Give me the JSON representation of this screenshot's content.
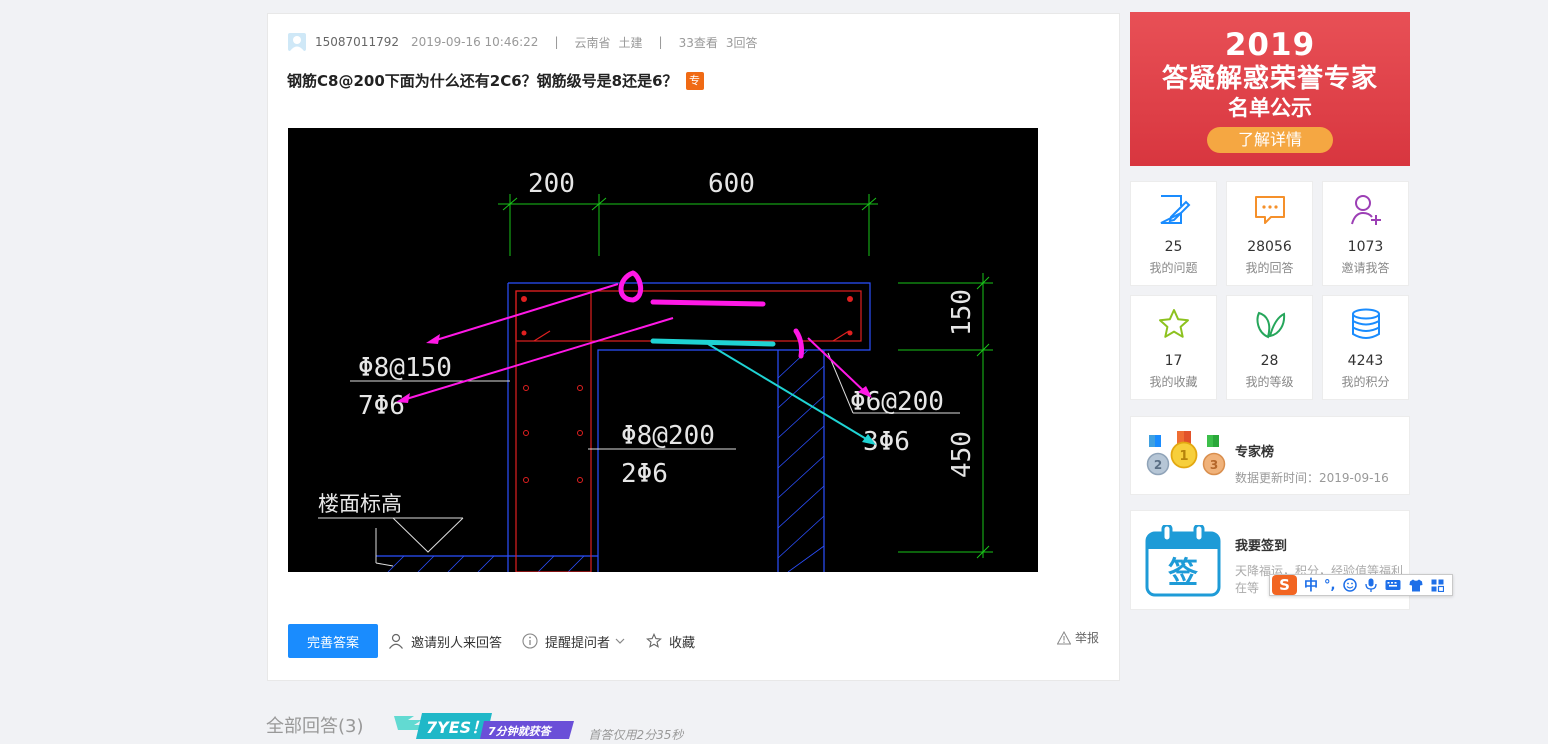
{
  "question": {
    "user": "15087011792",
    "datetime": "2019-09-16 10:46:22",
    "location": "云南省",
    "category": "土建",
    "views": "33查看",
    "answers": "3回答",
    "title": "钢筋C8@200下面为什么还有2C6？钢筋级号是8还是6？",
    "badge": "专"
  },
  "drawing": {
    "dims": [
      "200",
      "600",
      "150",
      "450"
    ],
    "labels": [
      "Φ8@150",
      "7Φ6",
      "Φ8@200",
      "2Φ6",
      "Φ6@200",
      "3Φ6",
      "楼面标高"
    ]
  },
  "actions": {
    "complete": "完善答案",
    "invite": "邀请别人来回答",
    "remind": "提醒提问者",
    "favorite": "收藏",
    "report": "举报"
  },
  "answers_section": {
    "title": "全部回答(3)",
    "badge_big": "7YES！",
    "badge_small": "7分钟就获答",
    "note": "首答仅用2分35秒"
  },
  "banner": {
    "year": "2019",
    "line1": "答疑解惑荣誉专家",
    "line2": "名单公示",
    "cta": "了解详情"
  },
  "stats": [
    {
      "icon": "edit-question-icon",
      "value": "25",
      "label": "我的问题",
      "color": "#1a8cfe"
    },
    {
      "icon": "chat-bubble-icon",
      "value": "28056",
      "label": "我的回答",
      "color": "#f5902a"
    },
    {
      "icon": "invite-user-icon",
      "value": "1073",
      "label": "邀请我答",
      "color": "#9c3fb5"
    },
    {
      "icon": "star-icon",
      "value": "17",
      "label": "我的收藏",
      "color": "#8dc21f"
    },
    {
      "icon": "leaf-icon",
      "value": "28",
      "label": "我的等级",
      "color": "#26a65b"
    },
    {
      "icon": "coin-stack-icon",
      "value": "4243",
      "label": "我的积分",
      "color": "#1a8cfe"
    }
  ],
  "experts": {
    "title": "专家榜",
    "subtitle": "数据更新时间：2019-09-16",
    "medals": [
      "2",
      "1",
      "3"
    ]
  },
  "checkin": {
    "title": "我要签到",
    "subtitle": "天降福运，积分，经验值等福利在等",
    "icon_text": "签"
  },
  "ime": {
    "logo": "S",
    "mode": "中",
    "punct": "°,"
  }
}
